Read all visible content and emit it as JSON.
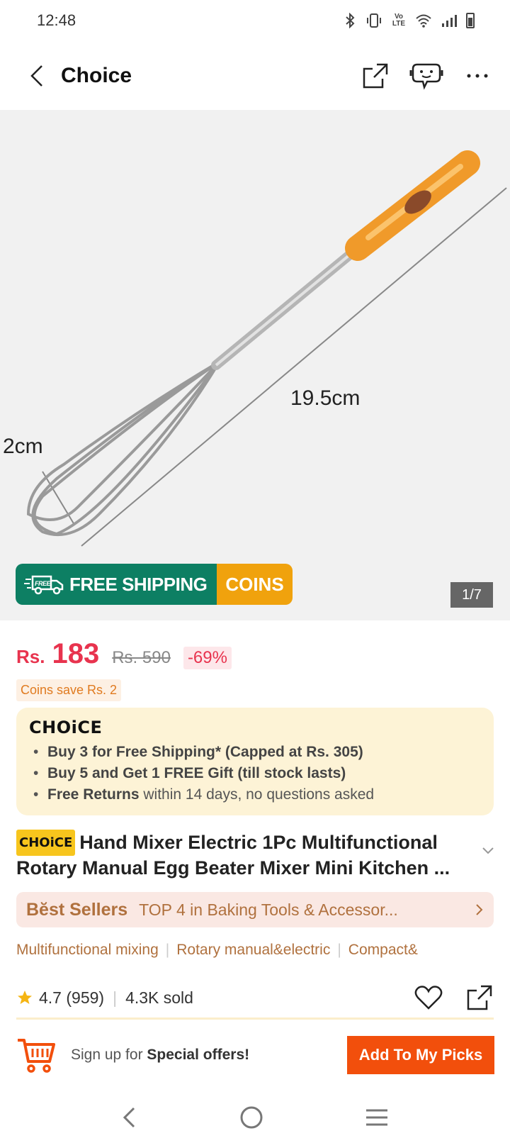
{
  "status_bar": {
    "time": "12:48",
    "icons": [
      "bluetooth-icon",
      "vibrate-icon",
      "volte-icon",
      "wifi-icon",
      "signal-icon",
      "battery-icon"
    ],
    "volte_label": "Vo LTE"
  },
  "app_bar": {
    "title": "Choice",
    "icons": [
      "back-icon",
      "share-icon",
      "support-icon",
      "more-icon"
    ]
  },
  "gallery": {
    "dimension_length": "19.5cm",
    "dimension_width": "2cm",
    "counter": "1/7",
    "promo_free_badge": "FREE",
    "promo_free_label": "FREE SHIPPING",
    "promo_coins_label": "COINS"
  },
  "price": {
    "currency": "Rs.",
    "current": "183",
    "original": "Rs. 590",
    "discount": "-69%",
    "coins_save": "Coins save Rs. 2"
  },
  "choice_card": {
    "logo": "CHOiCE",
    "bullets": [
      {
        "bold": "Buy 3 for  Free Shipping* (Capped at Rs. 305)",
        "rest": ""
      },
      {
        "bold": "Buy 5 and Get 1 FREE Gift (till stock lasts)",
        "rest": ""
      },
      {
        "bold": "Free Returns",
        "rest": " within 14 days, no questions asked"
      }
    ]
  },
  "product": {
    "badge": "CHOiCE",
    "title": "Hand Mixer Electric 1Pc Multifunctional Rotary Manual Egg Beater Mixer Mini Kitchen ..."
  },
  "bestseller": {
    "label": "Bĕst Sellers",
    "text": "TOP 4 in Baking Tools & Accessor..."
  },
  "tags": [
    "Multifunctional mixing",
    "Rotary manual&electric",
    "Compact&"
  ],
  "stats": {
    "rating": "4.7",
    "reviews": "(959)",
    "sold": "4.3K sold"
  },
  "signup": {
    "prefix": "Sign up for ",
    "highlight": "Special offers!",
    "button": "Add To My Picks"
  },
  "colors": {
    "accent_red": "#e8334e",
    "shipping_green": "#0d7f63",
    "coins_orange": "#f0a20d",
    "picks_orange": "#f24f0c",
    "bestseller_brown": "#b0713e"
  }
}
